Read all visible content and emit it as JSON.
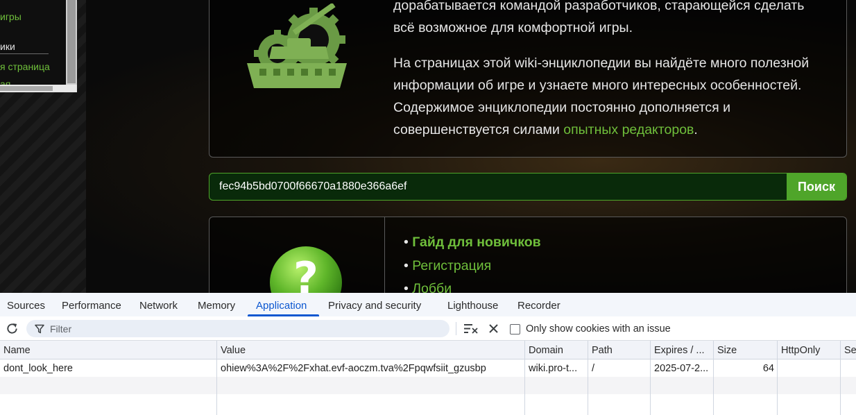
{
  "wiki": {
    "sidebar": {
      "link_games": "игры",
      "heading": "ики",
      "link_page": "я страница",
      "link_cut": "ая"
    },
    "intro": {
      "line1": "дорабатывается командой разработчиков, старающейся сделать",
      "line2": "всё возможное для комфортной игры.",
      "para2_line1": "На страницах этой wiki-энциклопедии вы найдёте много полезной",
      "para2_line2": "информации об игре и узнаете много интересных особенностей.",
      "para2_line3": "Содержимое энциклопедии постоянно дополняется и",
      "para2_line4_prefix": "совершенствуется силами ",
      "para2_link": "опытных редакторов",
      "para2_line4_suffix": "."
    },
    "search": {
      "value": "fec94b5bd0700f66670a1880e366a6ef",
      "button_label": "Поиск"
    },
    "guide": {
      "items": [
        {
          "bullet": "• ",
          "label": "Гайд для новичков"
        },
        {
          "bullet": "• ",
          "label": "Регистрация"
        },
        {
          "bullet": "• ",
          "label": "Лобби"
        }
      ]
    },
    "colors": {
      "accent_green": "#6fbf3b",
      "button_green": "#4fa52a"
    }
  },
  "devtools": {
    "tabs": [
      {
        "label": "Sources"
      },
      {
        "label": "Performance"
      },
      {
        "label": "Network"
      },
      {
        "label": "Memory"
      },
      {
        "label": "Application",
        "active": true
      },
      {
        "label": "Privacy and security"
      },
      {
        "label": "Lighthouse"
      },
      {
        "label": "Recorder"
      }
    ],
    "toolbar": {
      "filter_placeholder": "Filter",
      "only_issues_label": "Only show cookies with an issue",
      "icons": [
        "refresh-icon",
        "filter-icon",
        "clear-filter-icon",
        "delete-icon"
      ]
    },
    "cookies": {
      "columns": [
        "Name",
        "Value",
        "Domain",
        "Path",
        "Expires / ...",
        "Size",
        "HttpOnly",
        "Se"
      ],
      "rows": [
        {
          "name": "dont_look_here",
          "value": "ohiew%3A%2F%2Fxhat.evf-aoczm.tva%2Fpqwfsiit_gzusbp",
          "domain": "wiki.pro-t...",
          "path": "/",
          "expires": "2025-07-2...",
          "size": "64",
          "httponly": "",
          "secure": ""
        }
      ]
    },
    "colors": {
      "active_tab": "#0b57d0"
    }
  }
}
